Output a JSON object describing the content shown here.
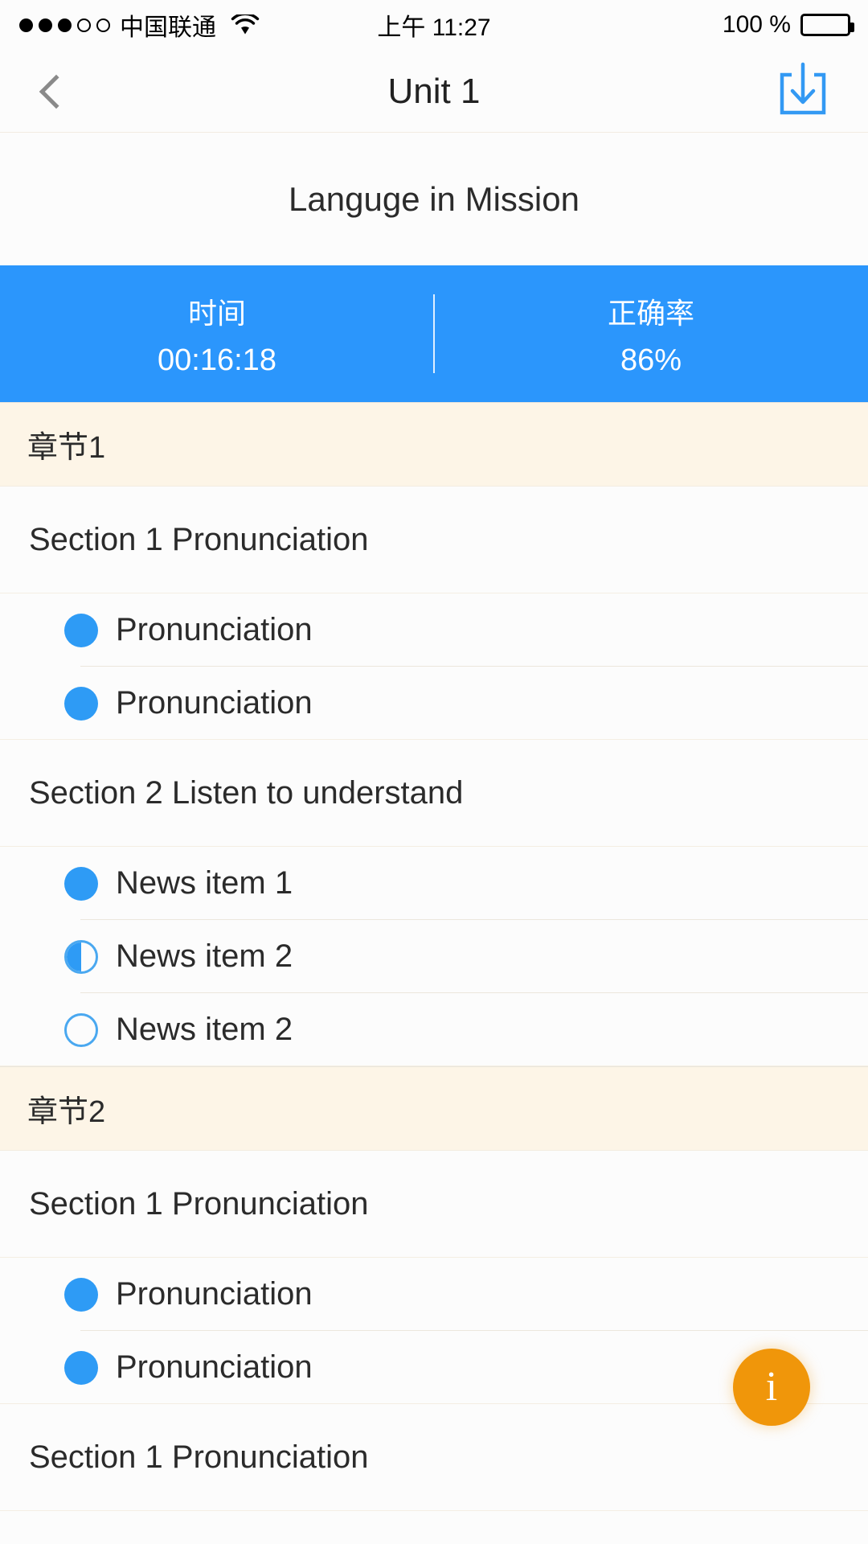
{
  "status_bar": {
    "signal_dots_filled": 3,
    "signal_dots_total": 5,
    "carrier": "中国联通",
    "wifi_icon": "wifi-icon",
    "time": "上午 11:27",
    "battery_percent": "100 %",
    "battery_level": 100
  },
  "nav": {
    "back_icon": "chevron-left-icon",
    "title": "Unit 1",
    "download_icon": "download-icon"
  },
  "subtitle": "Languge in Mission",
  "stats": {
    "time_label": "时间",
    "time_value": "00:16:18",
    "accuracy_label": "正确率",
    "accuracy_value": "86%"
  },
  "colors": {
    "accent_blue": "#2b96fc",
    "bullet_blue": "#2e9bf5",
    "chapter_cream": "#fdf5e7",
    "fab_orange": "#f0960a",
    "page_bg": "#fcfcfc"
  },
  "fab": {
    "icon": "info-icon",
    "label": "i"
  },
  "list": [
    {
      "kind": "chapter",
      "label": "章节1"
    },
    {
      "kind": "section",
      "label": "Section 1 Pronunciation"
    },
    {
      "kind": "item",
      "label": "Pronunciation",
      "state": "full"
    },
    {
      "kind": "item",
      "label": "Pronunciation",
      "state": "full",
      "last": true
    },
    {
      "kind": "section",
      "label": "Section 2 Listen to understand"
    },
    {
      "kind": "item",
      "label": "News item 1",
      "state": "full"
    },
    {
      "kind": "item",
      "label": "News item 2",
      "state": "half"
    },
    {
      "kind": "item",
      "label": "News item 2",
      "state": "empty",
      "last": true
    },
    {
      "kind": "chapter",
      "label": "章节2"
    },
    {
      "kind": "section",
      "label": "Section 1 Pronunciation"
    },
    {
      "kind": "item",
      "label": "Pronunciation",
      "state": "full"
    },
    {
      "kind": "item",
      "label": "Pronunciation",
      "state": "full",
      "last": true
    },
    {
      "kind": "section",
      "label": "Section 1 Pronunciation"
    }
  ]
}
